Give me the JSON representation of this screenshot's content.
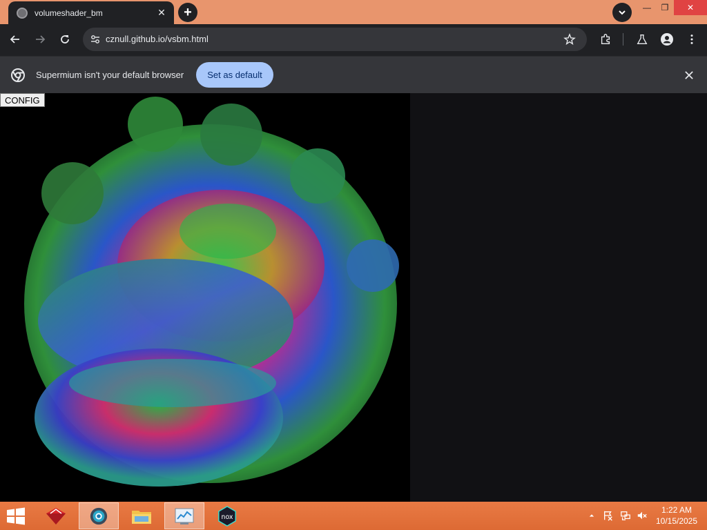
{
  "browser": {
    "tab_title": "volumeshader_bm",
    "tab_close": "✕",
    "new_tab": "+",
    "url": "cznull.github.io/vsbm.html",
    "window_controls": {
      "minimize": "—",
      "maximize": "❐",
      "close": "✕"
    }
  },
  "infobar": {
    "message": "Supermium isn't your default browser",
    "button_label": "Set as default"
  },
  "page": {
    "config_button": "CONFIG"
  },
  "taskbar": {
    "apps": [
      {
        "name": "ruby-app-icon",
        "active": false
      },
      {
        "name": "browser-app-icon",
        "active": true
      },
      {
        "name": "file-explorer-icon",
        "active": false
      },
      {
        "name": "task-manager-icon",
        "active": true
      },
      {
        "name": "nox-app-icon",
        "active": false
      }
    ],
    "tray_icons": [
      "show-hidden-icons",
      "action-center-flag-icon",
      "network-icon",
      "volume-muted-icon"
    ],
    "time": "1:22 AM",
    "date": "10/15/2025"
  },
  "colors": {
    "tabstrip": "#e8956d",
    "toolbar": "#202124",
    "infobar": "#35363a",
    "accent_button": "#a8c7fa",
    "taskbar": "#e8713a"
  }
}
